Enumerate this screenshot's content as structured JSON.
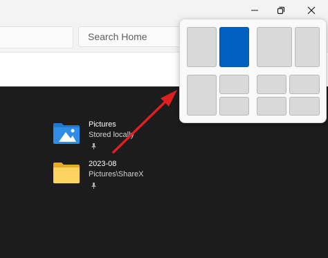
{
  "search": {
    "placeholder": "Search Home"
  },
  "window_controls": {
    "restore_icon": "restore-icon",
    "close_icon": "close-icon",
    "minimize_icon": "minimize-icon"
  },
  "quick_access": [
    {
      "name": "Pictures",
      "location": "Stored locally",
      "icon": "pictures-folder-icon",
      "pinned": true
    },
    {
      "name": "2023-08",
      "location": "Pictures\\ShareX",
      "icon": "folder-icon",
      "pinned": true
    }
  ],
  "snap_layouts": {
    "layouts": [
      "half-half",
      "two-thirds-one-third",
      "quadrants-left-column",
      "quadrants"
    ],
    "active_zone": "half-half-right"
  },
  "colors": {
    "accent": "#0060c0",
    "annotation_arrow": "#e02020",
    "content_bg": "#1c1c1c"
  }
}
